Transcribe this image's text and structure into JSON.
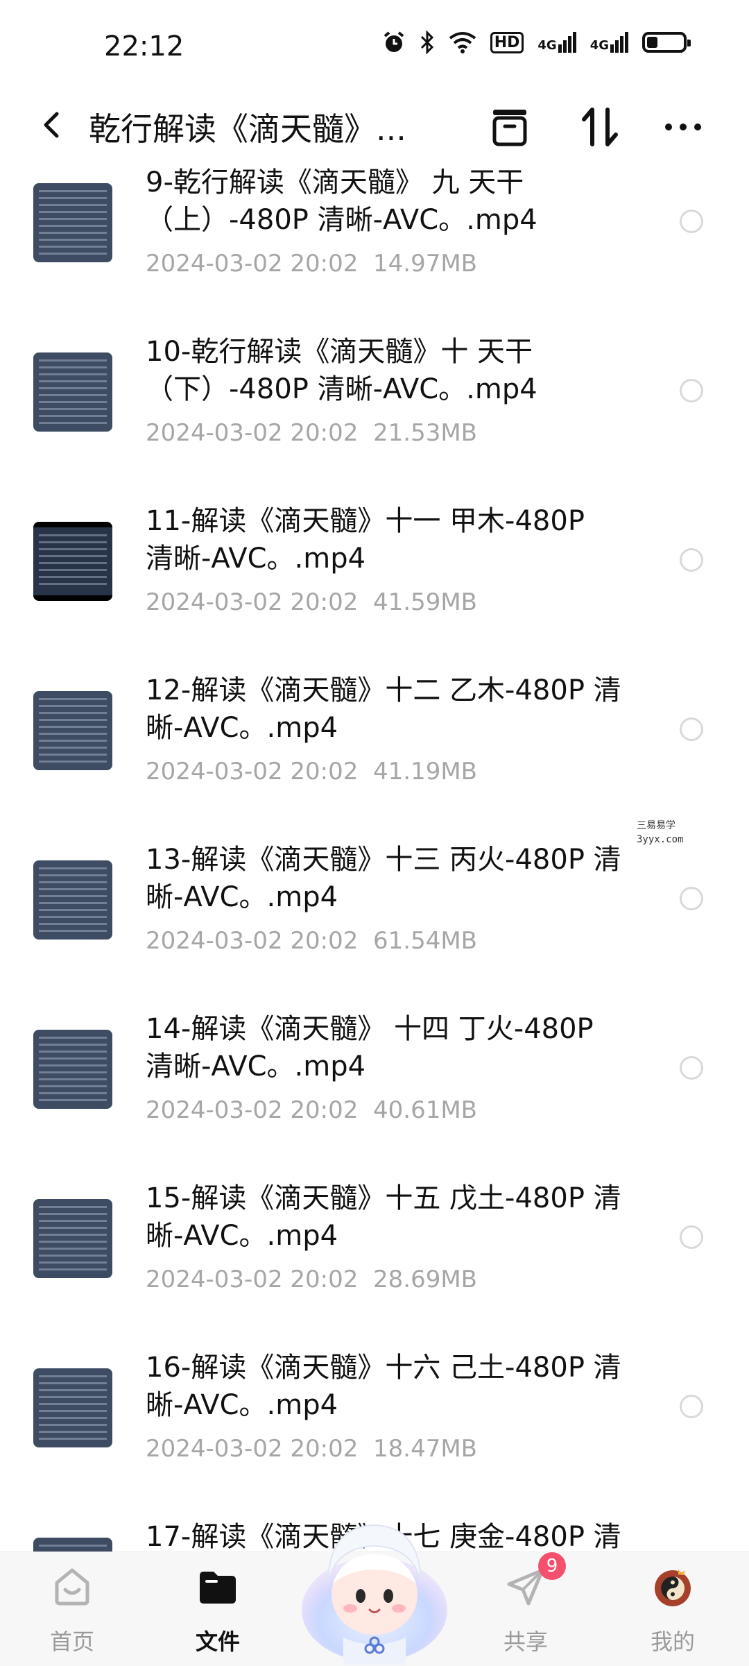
{
  "status_bar": {
    "time": "22:12",
    "hd_label": "HD",
    "signal1_label": "4G",
    "signal2_label": "4G",
    "battery_level": 0.3
  },
  "header": {
    "title": "乾行解读《滴天髓》...",
    "icons": [
      "back-icon",
      "archive-box-icon",
      "sort-icon",
      "more-icon"
    ]
  },
  "files": [
    {
      "line1": "9-乾行解读《滴天髓》 九  天干",
      "line2": "（上）-480P 清晰-AVC。.mp4",
      "date": "2024-03-02  20:02",
      "size": "14.97MB"
    },
    {
      "line1": "10-乾行解读《滴天髓》十 天干",
      "line2": "（下）-480P 清晰-AVC。.mp4",
      "date": "2024-03-02  20:02",
      "size": "21.53MB"
    },
    {
      "line1": "11-解读《滴天髓》十一  甲木-480P",
      "line2": "清晰-AVC。.mp4",
      "date": "2024-03-02  20:02",
      "size": "41.59MB"
    },
    {
      "line1": "12-解读《滴天髓》十二 乙木-480P 清",
      "line2": "晰-AVC。.mp4",
      "date": "2024-03-02  20:02",
      "size": "41.19MB"
    },
    {
      "line1": "13-解读《滴天髓》十三 丙火-480P 清",
      "line2": "晰-AVC。.mp4",
      "date": "2024-03-02  20:02",
      "size": "61.54MB"
    },
    {
      "line1": "14-解读《滴天髓》 十四  丁火-480P",
      "line2": "清晰-AVC。.mp4",
      "date": "2024-03-02  20:02",
      "size": "40.61MB"
    },
    {
      "line1": "15-解读《滴天髓》十五 戊土-480P 清",
      "line2": "晰-AVC。.mp4",
      "date": "2024-03-02  20:02",
      "size": "28.69MB"
    },
    {
      "line1": "16-解读《滴天髓》十六 己土-480P 清",
      "line2": "晰-AVC。.mp4",
      "date": "2024-03-02  20:02",
      "size": "18.47MB"
    },
    {
      "line1": "17-解读《滴天髓》十七 庚金-480P 清",
      "line2": "",
      "date": "",
      "size": ""
    }
  ],
  "watermark": {
    "line1": "三易易学",
    "line2": "3yyx.com"
  },
  "bottom_nav": {
    "home": "首页",
    "files": "文件",
    "share": "共享",
    "share_badge": "9",
    "mine": "我的"
  },
  "colors": {
    "meta_text": "#a6a6a6",
    "badge": "#f4506d",
    "thumb_bg": "#3d4b63"
  }
}
